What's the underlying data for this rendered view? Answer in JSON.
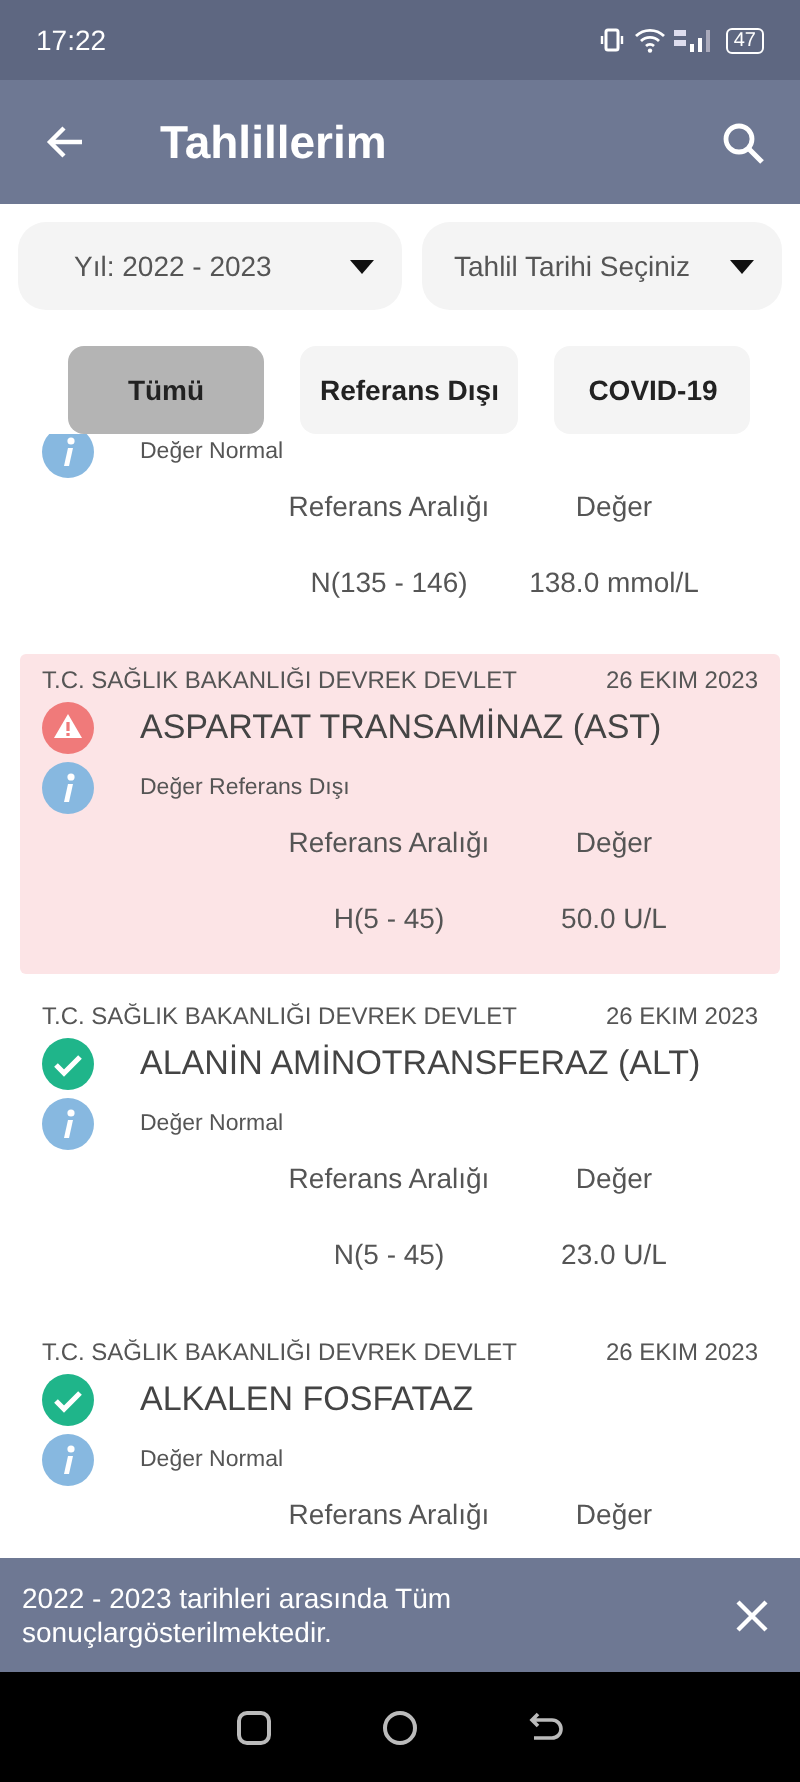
{
  "status_bar": {
    "time": "17:22",
    "battery": "47"
  },
  "app_bar": {
    "title": "Tahlillerim"
  },
  "filters": [
    {
      "label": "Yıl: 2022 - 2023"
    },
    {
      "label": "Tahlil Tarihi Seçiniz"
    }
  ],
  "tabs": [
    {
      "label": "Tümü",
      "selected": true
    },
    {
      "label": "Referans Dışı",
      "selected": false
    },
    {
      "label": "COVID-19",
      "selected": false
    }
  ],
  "results": [
    {
      "note": "Değer Normal",
      "range_label": "Referans Aralığı",
      "value_label": "Değer",
      "range": "N(135 - 146)",
      "value": "138.0 mmol/L",
      "out_of_range": false
    },
    {
      "hospital": "T.C. SAĞLIK BAKANLIĞI DEVREK DEVLET",
      "date": "26 EKIM 2023",
      "title": "ASPARTAT TRANSAMİNAZ (AST)",
      "note": "Değer Referans Dışı",
      "range_label": "Referans Aralığı",
      "value_label": "Değer",
      "range": "H(5 - 45)",
      "value": "50.0 U/L",
      "out_of_range": true
    },
    {
      "hospital": "T.C. SAĞLIK BAKANLIĞI DEVREK DEVLET",
      "date": "26 EKIM 2023",
      "title": "ALANİN AMİNOTRANSFERAZ (ALT)",
      "note": "Değer Normal",
      "range_label": "Referans Aralığı",
      "value_label": "Değer",
      "range": "N(5 - 45)",
      "value": "23.0 U/L",
      "out_of_range": false
    },
    {
      "hospital": "T.C. SAĞLIK BAKANLIĞI DEVREK DEVLET",
      "date": "26 EKIM 2023",
      "title": "ALKALEN FOSFATAZ",
      "note": "Değer Normal",
      "range_label": "Referans Aralığı",
      "value_label": "Değer",
      "out_of_range": false
    }
  ],
  "snackbar": {
    "message": "2022 - 2023 tarihleri arasında Tüm sonuçlargösterilmektedir."
  }
}
